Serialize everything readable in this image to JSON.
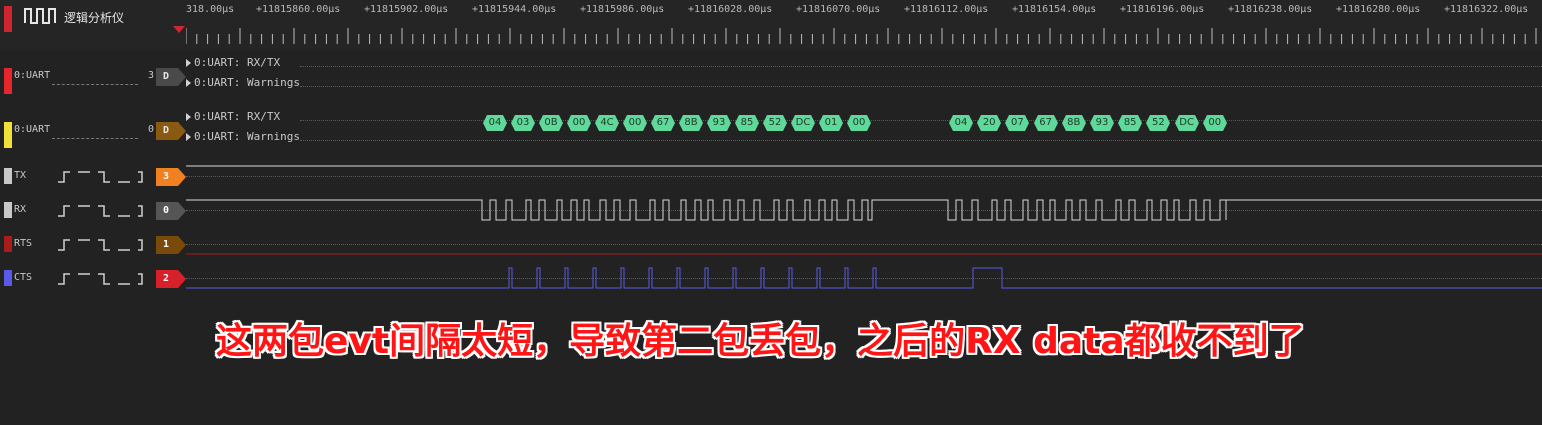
{
  "app": {
    "title": "逻辑分析仪",
    "accent_color": "#d0262f"
  },
  "timeline": {
    "ticks": [
      "318.00µs",
      "+11815860.00µs",
      "+11815902.00µs",
      "+11815944.00µs",
      "+11815986.00µs",
      "+11816028.00µs",
      "+11816070.00µs",
      "+11816112.00µs",
      "+11816154.00µs",
      "+11816196.00µs",
      "+11816238.00µs",
      "+11816280.00µs",
      "+11816322.00µs"
    ]
  },
  "channels": [
    {
      "id": "uart0a",
      "name": "0:UART",
      "count": "3",
      "tag": "D",
      "color": "#e8242c",
      "tag_color": "#4a4a4a",
      "sub_rows": [
        "0:UART: RX/TX",
        "0:UART: Warnings"
      ]
    },
    {
      "id": "uart0b",
      "name": "0:UART",
      "count": "0",
      "tag": "D",
      "color": "#f2e03a",
      "tag_color": "#8a5a12",
      "sub_rows": [
        "0:UART: RX/TX",
        "0:UART: Warnings"
      ]
    },
    {
      "id": "tx",
      "name": "TX",
      "tag": "3",
      "color": "#c8c8c8",
      "tag_color": "#f08020"
    },
    {
      "id": "rx",
      "name": "RX",
      "tag": "0",
      "color": "#c8c8c8",
      "tag_color": "#555555"
    },
    {
      "id": "rts",
      "name": "RTS",
      "tag": "1",
      "color": "#a81c1c",
      "tag_color": "#7a4a0a"
    },
    {
      "id": "cts",
      "name": "CTS",
      "tag": "2",
      "color": "#5a5ae6",
      "tag_color": "#d8202a"
    }
  ],
  "decoded_bytes_packet1": [
    "04",
    "03",
    "0B",
    "00",
    "4C",
    "00",
    "67",
    "8B",
    "93",
    "85",
    "52",
    "DC",
    "01",
    "00"
  ],
  "decoded_bytes_packet2": [
    "04",
    "20",
    "07",
    "67",
    "8B",
    "93",
    "85",
    "52",
    "DC",
    "00"
  ],
  "annotation": "这两包evt间隔太短，导致第二包丢包，之后的RX data都收不到了",
  "colors": {
    "background": "#222222",
    "byte_badge": "#5fd99a",
    "rx_line": "#d8d8d8",
    "rts_line": "#a81c1c",
    "cts_line": "#5a5ae6"
  }
}
